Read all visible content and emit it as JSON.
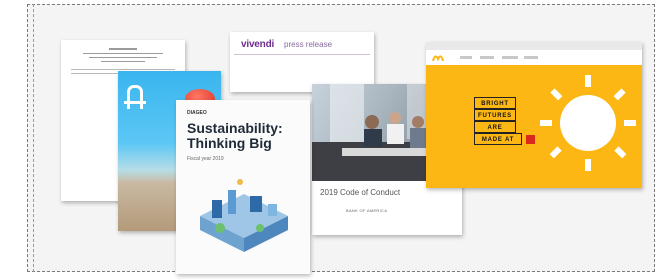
{
  "documents": {
    "vivendi": {
      "brand": "vivendi",
      "doc_type": "press release"
    },
    "sustainability": {
      "tag": "DIAGEO",
      "title": "Sustainability: Thinking Big",
      "subtitle": "Fiscal year 2019"
    },
    "code_of_conduct": {
      "title": "2019 Code of Conduct",
      "brand": "BANK OF AMERICA"
    },
    "website": {
      "headline_lines": [
        "BRIGHT",
        "FUTURES",
        "ARE",
        "MADE AT"
      ]
    }
  },
  "colors": {
    "panel_bg": "#f4f4f4",
    "web_yellow": "#fcb714",
    "vivendi_purple": "#6f2b8f",
    "mc_red": "#da291c"
  }
}
